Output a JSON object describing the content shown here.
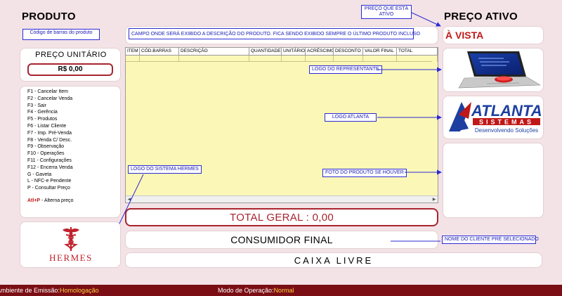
{
  "headings": {
    "produto": "PRODUTO",
    "preco_ativo": "PREÇO ATIVO"
  },
  "product": {
    "barcode_label": "Código de barras do produto",
    "description_callout": "CAMPO ONDE SERÁ EXIBIDO A DESCRIÇÃO DO PRODUTO. FICA SENDO EXIBIDO SEMPRE O ÚLTIMO PRODUTO INCLUSO"
  },
  "unit_price": {
    "title": "PREÇO UNITÁRIO",
    "value": "R$ 0,00"
  },
  "shortcuts": [
    "F1 - Cancelar Item",
    "F2 - Cancelar Venda",
    "F3 - Sair",
    "F4 - Gerência",
    "F5 - Produtos",
    "F6 - Listar Cliente",
    "F7 - Imp. Pré-Venda",
    "F8 - Venda C/ Desc.",
    "F9 - Observação",
    "F10 - Operações",
    "F11 - Configurações",
    "F12 - Encerra Venda",
    "G - Gaveta",
    "L - NFC-e Pendente",
    "P - Consultar Preço"
  ],
  "alt_shortcut": {
    "key": "Atl+P",
    "label": "- Alterna preço"
  },
  "grid": {
    "columns": [
      "ITEM",
      "CÓD.BARRAS",
      "DESCRIÇÃO",
      "QUANTIDADE",
      "UNITÁRIO",
      "ACRÉSCIMO",
      "DESCONTO",
      "VALOR FINAL",
      "TOTAL"
    ]
  },
  "callouts": {
    "price_active": "PREÇO QUE ESTÁ ATIVO",
    "rep_logo": "LOGO DO REPRESENTANTE",
    "atlanta_logo": "LOGO ATLANTA",
    "hermes_logo": "LOGO DO SISTEMA HERMES",
    "product_photo": "FOTO DO PRODUTO SE HOUVER",
    "client_name": "NOME DO CLIENTE PRÉ SELECIONADO"
  },
  "price_mode": "À VISTA",
  "total": "TOTAL GERAL : 0,00",
  "consumer": "CONSUMIDOR FINAL",
  "caixa_status": "CAIXA LIVRE",
  "brand": {
    "hermes": "HERMES",
    "atlanta_name": "ATLANTA",
    "atlanta_sub": "SISTEMAS",
    "atlanta_slogan": "Desenvolvendo Soluções"
  },
  "status_bar": {
    "env_label": "Ambiente de Emissão:",
    "env_value": "Homologação",
    "mode_label": "Modo de Operação:",
    "mode_value": "Normal"
  },
  "colors": {
    "background": "#f3e3e6",
    "accent_red": "#a8242f",
    "grid_bg": "#fbf7b6",
    "callout_blue": "#2b2bd6",
    "status_bar": "#7a0e14",
    "status_highlight": "#ffd23f"
  }
}
